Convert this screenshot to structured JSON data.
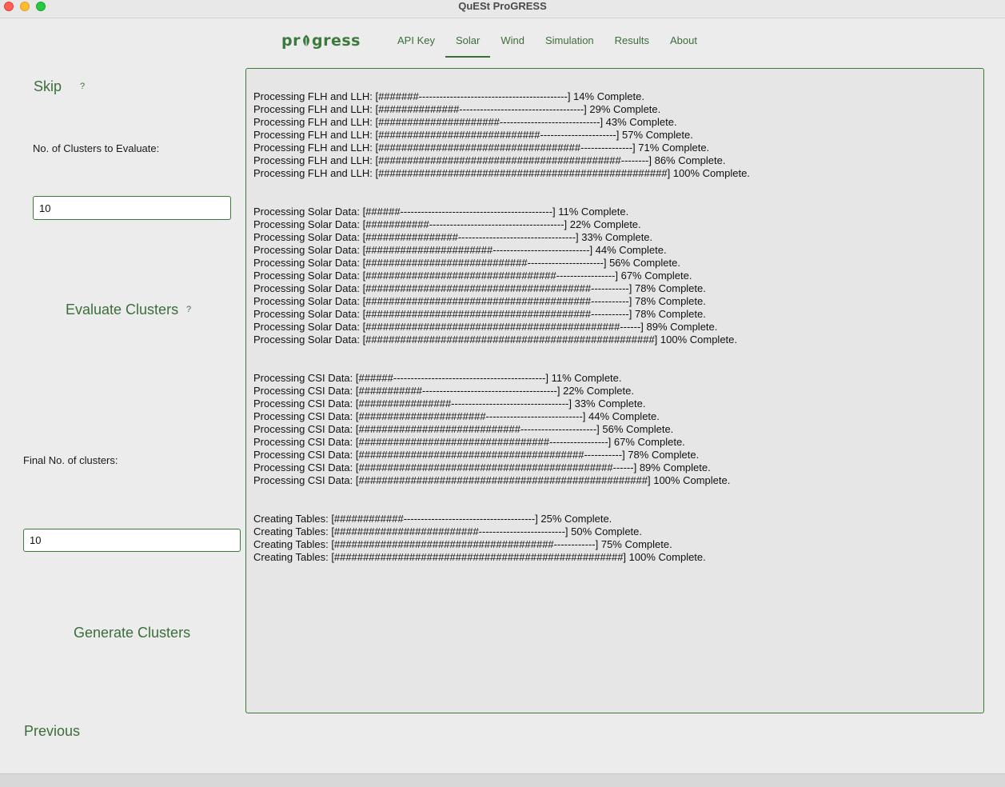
{
  "window": {
    "title": "QuESt ProGRESS"
  },
  "logo": {
    "text_left": "pr",
    "text_right": "gress",
    "color": "#3b7a3b"
  },
  "nav": {
    "tabs": [
      {
        "label": "API Key",
        "active": false
      },
      {
        "label": "Solar",
        "active": true
      },
      {
        "label": "Wind",
        "active": false
      },
      {
        "label": "Simulation",
        "active": false
      },
      {
        "label": "Results",
        "active": false
      },
      {
        "label": "About",
        "active": false
      }
    ]
  },
  "sidebar": {
    "skip_label": "Skip",
    "help_glyph": "?",
    "clusters_to_evaluate_label": "No. of Clusters to Evaluate:",
    "clusters_to_evaluate_value": "10",
    "evaluate_label": "Evaluate Clusters",
    "final_clusters_label": "Final No. of clusters:",
    "final_clusters_value": "10",
    "generate_label": "Generate Clusters",
    "previous_label": "Previous"
  },
  "console": {
    "groups": [
      [
        "Processing FLH and LLH: [#######-------------------------------------------] 14% Complete.",
        "Processing FLH and LLH: [##############------------------------------------] 29% Complete.",
        "Processing FLH and LLH: [#####################-----------------------------] 43% Complete.",
        "Processing FLH and LLH: [############################----------------------] 57% Complete.",
        "Processing FLH and LLH: [###################################---------------] 71% Complete.",
        "Processing FLH and LLH: [##########################################--------] 86% Complete.",
        "Processing FLH and LLH: [##################################################] 100% Complete."
      ],
      [
        "Processing Solar Data: [######--------------------------------------------] 11% Complete.",
        "Processing Solar Data: [###########---------------------------------------] 22% Complete.",
        "Processing Solar Data: [################----------------------------------] 33% Complete.",
        "Processing Solar Data: [######################----------------------------] 44% Complete.",
        "Processing Solar Data: [############################----------------------] 56% Complete.",
        "Processing Solar Data: [#################################-----------------] 67% Complete.",
        "Processing Solar Data: [#######################################-----------] 78% Complete.",
        "Processing Solar Data: [#######################################-----------] 78% Complete.",
        "Processing Solar Data: [#######################################-----------] 78% Complete.",
        "Processing Solar Data: [############################################------] 89% Complete.",
        "Processing Solar Data: [##################################################] 100% Complete."
      ],
      [
        "Processing CSI Data: [######--------------------------------------------] 11% Complete.",
        "Processing CSI Data: [###########---------------------------------------] 22% Complete.",
        "Processing CSI Data: [################----------------------------------] 33% Complete.",
        "Processing CSI Data: [######################----------------------------] 44% Complete.",
        "Processing CSI Data: [############################----------------------] 56% Complete.",
        "Processing CSI Data: [#################################-----------------] 67% Complete.",
        "Processing CSI Data: [#######################################-----------] 78% Complete.",
        "Processing CSI Data: [############################################------] 89% Complete.",
        "Processing CSI Data: [##################################################] 100% Complete."
      ],
      [
        "Creating Tables: [############--------------------------------------] 25% Complete.",
        "Creating Tables: [#########################-------------------------] 50% Complete.",
        "Creating Tables: [######################################------------] 75% Complete.",
        "Creating Tables: [##################################################] 100% Complete."
      ]
    ]
  },
  "colors": {
    "accent": "#3b6e3b",
    "window_background": "#ececec",
    "console_background": "#e6e6e6"
  },
  "icons": {
    "logo_mark": "leaf-icon",
    "window_controls": [
      "close-dot",
      "minimize-dot",
      "maximize-dot"
    ]
  }
}
